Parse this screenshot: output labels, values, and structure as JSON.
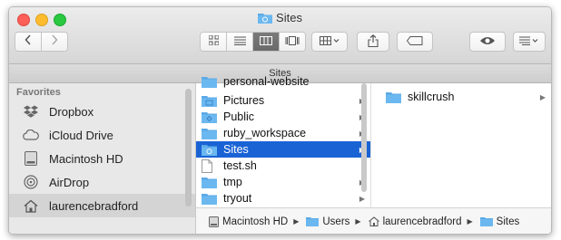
{
  "window": {
    "title": "Sites"
  },
  "toolbar": {
    "path_label": "Sites"
  },
  "sidebar": {
    "heading": "Favorites",
    "items": [
      {
        "label": "Dropbox",
        "icon": "dropbox-icon"
      },
      {
        "label": "iCloud Drive",
        "icon": "cloud-icon"
      },
      {
        "label": "Macintosh HD",
        "icon": "hard-drive-icon"
      },
      {
        "label": "AirDrop",
        "icon": "airdrop-icon"
      },
      {
        "label": "laurencebradford",
        "icon": "home-icon",
        "selected": true
      }
    ]
  },
  "column1": {
    "partial_top": "personal-website",
    "items": [
      {
        "label": "Pictures",
        "type": "folder",
        "arrow": true
      },
      {
        "label": "Public",
        "type": "folder",
        "arrow": true
      },
      {
        "label": "ruby_workspace",
        "type": "folder",
        "arrow": true
      },
      {
        "label": "Sites",
        "type": "folder",
        "arrow": true,
        "selected": true
      },
      {
        "label": "test.sh",
        "type": "file",
        "arrow": false
      },
      {
        "label": "tmp",
        "type": "folder",
        "arrow": true
      },
      {
        "label": "tryout",
        "type": "folder",
        "arrow": true
      }
    ]
  },
  "column2": {
    "items": [
      {
        "label": "skillcrush",
        "type": "folder",
        "arrow": true
      }
    ]
  },
  "pathbar": {
    "crumbs": [
      {
        "label": "Macintosh HD",
        "icon": "hard-drive-icon"
      },
      {
        "label": "Users",
        "icon": "folder-icon"
      },
      {
        "label": "laurencebradford",
        "icon": "home-icon"
      },
      {
        "label": "Sites",
        "icon": "folder-icon"
      }
    ]
  },
  "colors": {
    "selection": "#1a63d5",
    "folder": "#5aa9e6"
  }
}
